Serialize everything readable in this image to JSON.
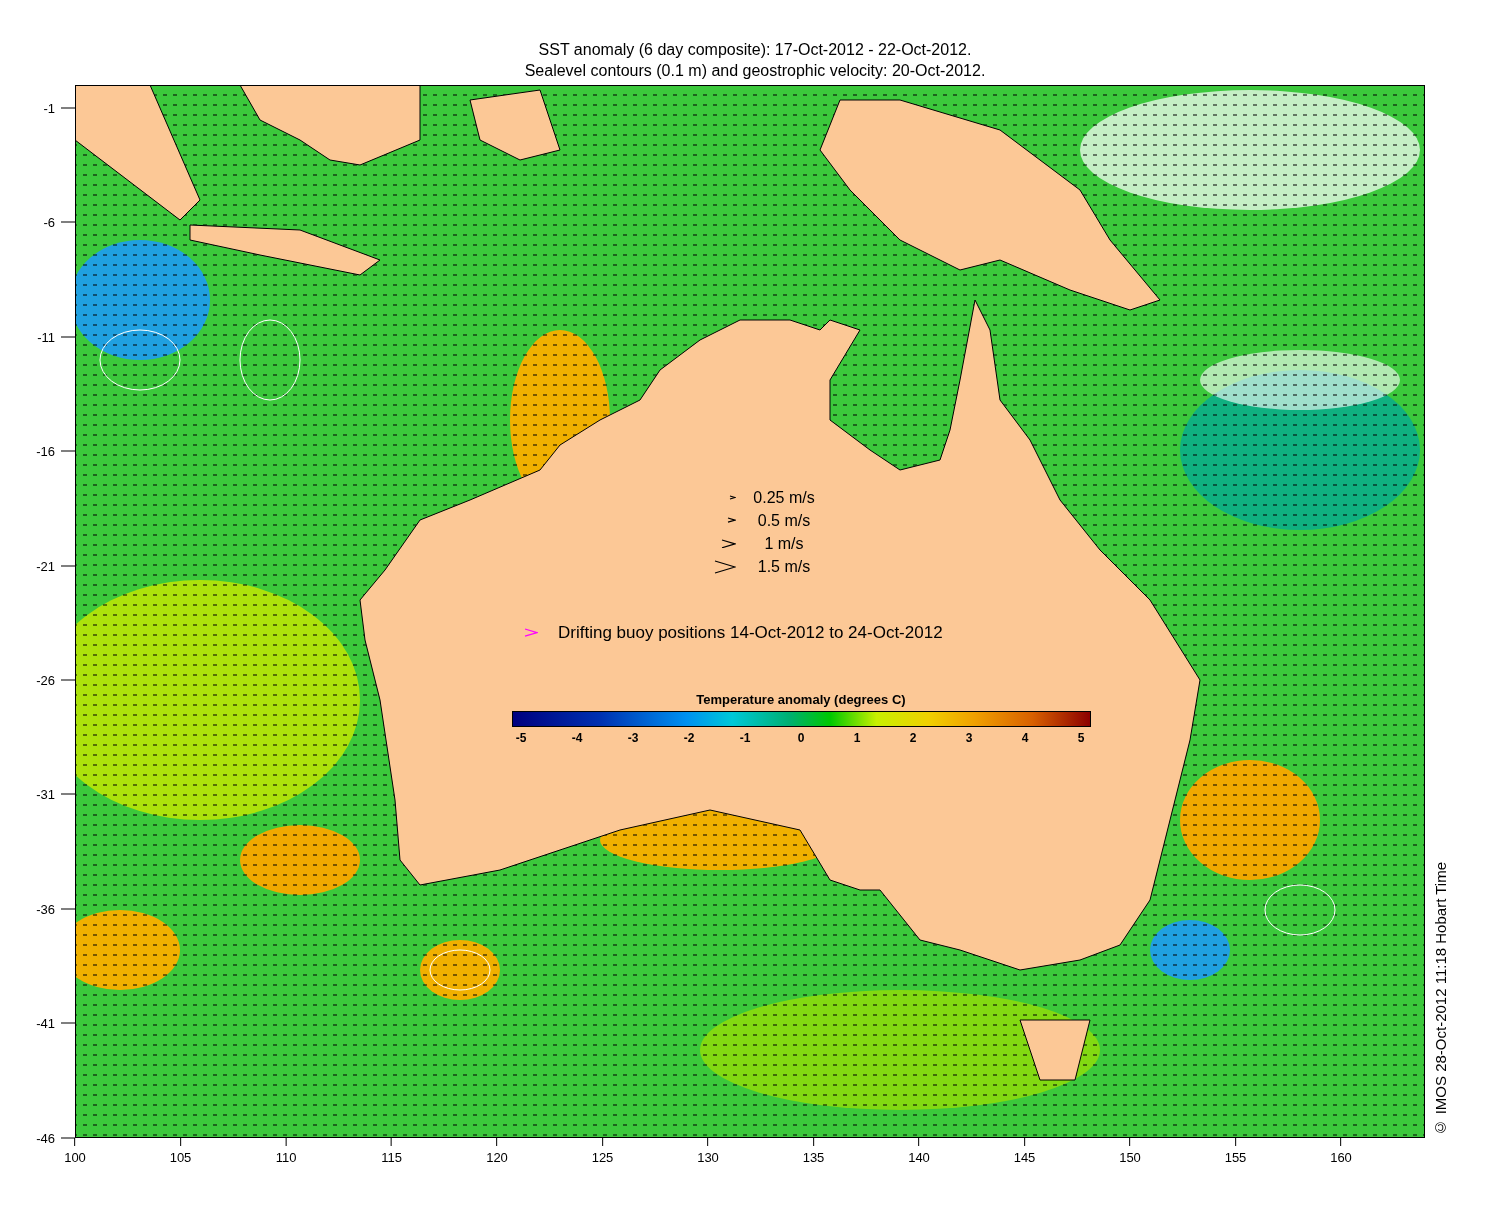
{
  "title_lines": [
    "SST anomaly (6 day composite): 17-Oct-2012 - 22-Oct-2012.",
    "Sealevel contours (0.1 m) and geostrophic velocity: 20-Oct-2012."
  ],
  "y_axis": {
    "ticks": [
      "-1",
      "-6",
      "-11",
      "-16",
      "-21",
      "-26",
      "-31",
      "-36",
      "-41",
      "-46"
    ]
  },
  "x_axis": {
    "ticks": [
      "100",
      "105",
      "110",
      "115",
      "120",
      "125",
      "130",
      "135",
      "140",
      "145",
      "150",
      "155",
      "160"
    ]
  },
  "velocity_legend": [
    {
      "label": "0.25 m/s"
    },
    {
      "label": "0.5 m/s"
    },
    {
      "label": "1 m/s"
    },
    {
      "label": "1.5 m/s"
    }
  ],
  "buoy_legend": {
    "label": "Drifting buoy positions 14-Oct-2012 to 24-Oct-2012"
  },
  "colorbar": {
    "title": "Temperature anomaly (degrees C)",
    "ticks": [
      "-5",
      "-4",
      "-3",
      "-2",
      "-1",
      "0",
      "1",
      "2",
      "3",
      "4",
      "5"
    ]
  },
  "credit": "© IMOS 28-Oct-2012 11:18 Hobart Time"
}
